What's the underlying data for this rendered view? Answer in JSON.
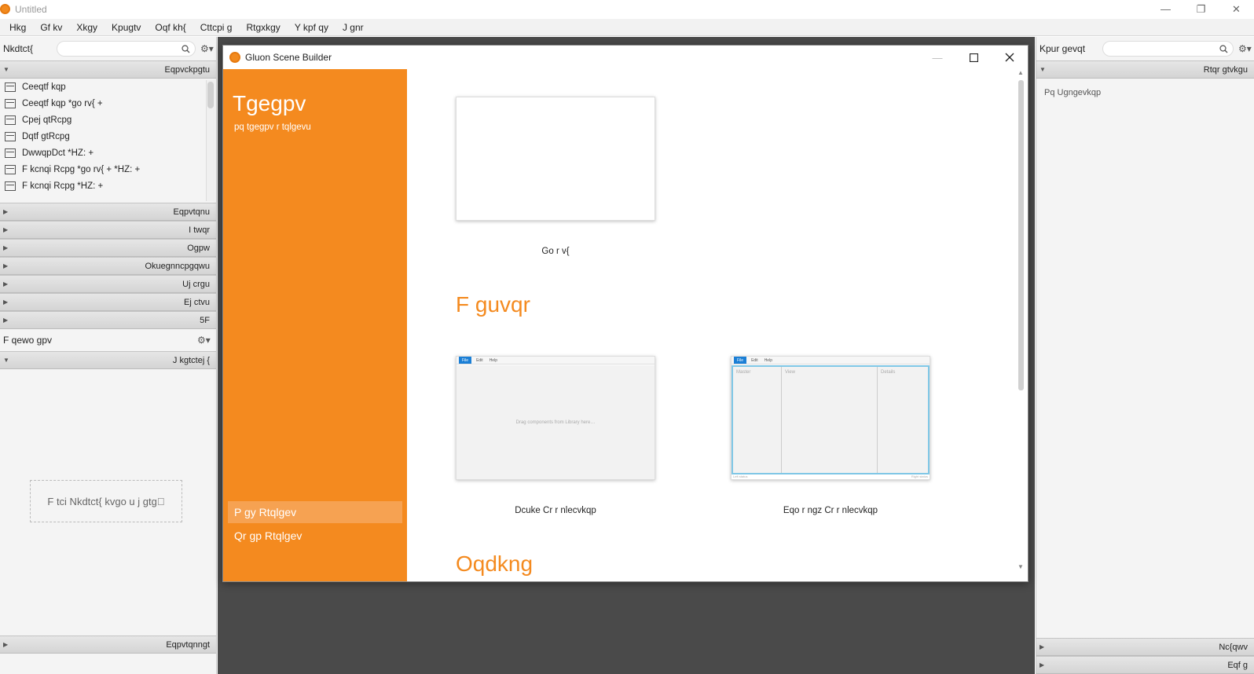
{
  "window": {
    "title": "Untitled",
    "minimize": "—",
    "restore": "❐",
    "close": "✕"
  },
  "menubar": [
    "Hkg",
    "Gf kv",
    "Xkgy",
    "Kpugtv",
    "Oqf kh{",
    "Cttcpi g",
    "Rtgxkgy",
    "Y kpf qy",
    "J gnr"
  ],
  "left": {
    "library_label": "Nkdtct{",
    "containers_header": "Eqpvckpgtu",
    "items": [
      "Ceeqtf kqp",
      "Ceeqtf kqp  *go rv{ +",
      "Cpej qtRcpg",
      "Dqtf gtRcpg",
      "DwwqpDct  *HZ: +",
      "F kcnqi Rcpg *go rv{ + *HZ: +",
      "F kcnqi Rcpg  *HZ: +"
    ],
    "sections": [
      "Eqpvtqnu",
      "I twqr",
      "Ogpw",
      "Okuegnncpgqwu",
      "Uj crgu",
      "Ej ctvu",
      "5F"
    ],
    "document_label": "F qewo gpv",
    "hierarchy_header": "J kgtctej {",
    "drop_hint": "F tci  Nkdtct{ kvgo u j gtg\u0000",
    "controller_header": "Eqpvtqnngt"
  },
  "right": {
    "inspector_label": "Kpur gevqt",
    "properties_header": "Rtqr gtvkgu",
    "empty_text": "Pq Ugngevkqp",
    "layout_header": "Nc{qwv",
    "code_header": "Eqf g"
  },
  "dialog": {
    "title": "Gluon Scene Builder",
    "recent_title": "Tgegpv",
    "recent_empty": "pq tgegpv r tqlgevu",
    "open_project": "Qr gp Rtqlgev",
    "new_project": "P gy  Rtqlgev",
    "empty_label": "Go r v{",
    "desktop_title": "F guvqr",
    "basic_app": "Dcuke Cr r nlecvkqp",
    "complex_app": "Eqo r ngz Cr r nlecvkqp",
    "mobile_title": "Oqdkng",
    "preview": {
      "file": "File",
      "edit": "Edit",
      "help": "Help",
      "drag_hint": "Drag components from Library here…",
      "master": "Master",
      "view": "View",
      "details": "Details",
      "left_status": "Left status",
      "right_status": "Right status"
    }
  },
  "colors": {
    "accent": "#f48a1f",
    "accent_light": "#f6a252",
    "dark_bg": "#4a4a4a"
  }
}
